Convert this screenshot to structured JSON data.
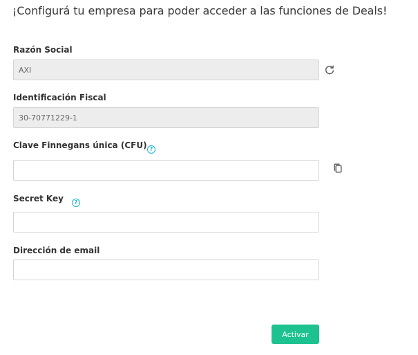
{
  "page": {
    "heading": "¡Configurá tu empresa para poder acceder a las funciones de Deals!"
  },
  "form": {
    "razon_social": {
      "label": "Razón Social",
      "value": "AXI",
      "refresh_icon": "refresh-icon"
    },
    "identificacion_fiscal": {
      "label": "Identificación Fiscal",
      "value": "30-70771229-1"
    },
    "clave_finnegans": {
      "label": "Clave Finnegans única (CFU)",
      "value": "",
      "help_icon": "question-circle-icon",
      "copy_icon": "copy-icon"
    },
    "secret_key": {
      "label": "Secret Key",
      "value": "",
      "help_icon": "question-circle-icon"
    },
    "email": {
      "label": "Dirección de email",
      "value": ""
    },
    "submit_label": "Activar"
  },
  "colors": {
    "accent": "#1cc28f",
    "help": "#1ab7d6",
    "readonly_bg": "#ededed",
    "border": "#d4d4d4"
  }
}
